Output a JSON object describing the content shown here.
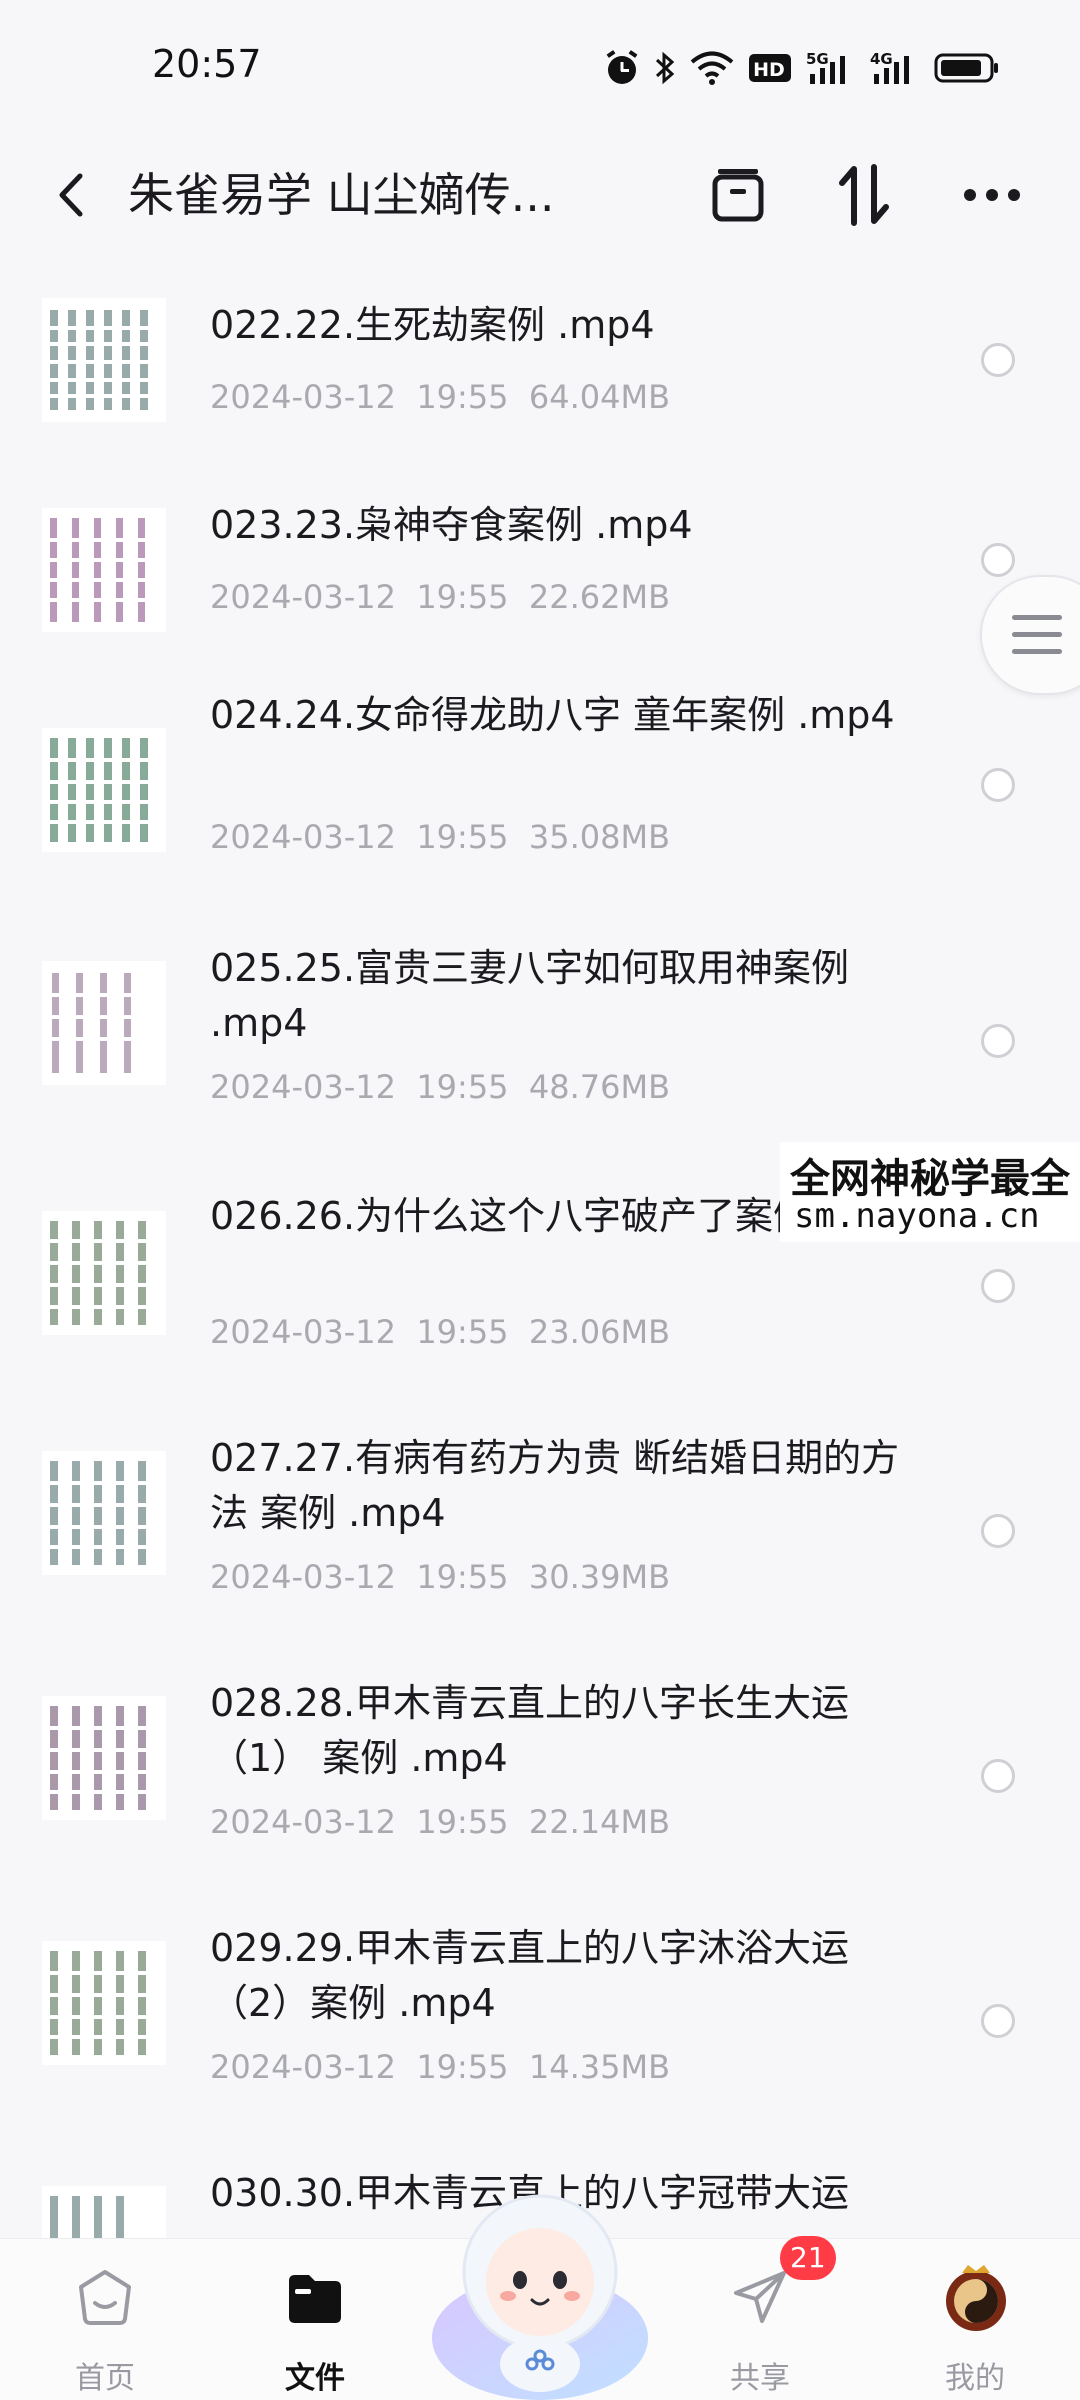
{
  "status_bar": {
    "time": "20:57",
    "icons": [
      "alarm-icon",
      "bluetooth-icon",
      "wifi-icon",
      "hd-icon",
      "signal-5g-icon",
      "signal-4g-icon",
      "battery-icon"
    ],
    "hd_label": "HD",
    "net1_label": "5G",
    "net2_label": "4G"
  },
  "header": {
    "title": "朱雀易学 山尘嫡传...",
    "back_icon": "back-arrow-icon",
    "actions": [
      "archive-icon",
      "sort-icon",
      "more-icon"
    ]
  },
  "files": [
    {
      "name": "022.22.生死劫案例 .mp4",
      "date": "2024-03-12",
      "time": "19:55",
      "size": "64.04MB"
    },
    {
      "name": "023.23.枭神夺食案例 .mp4",
      "date": "2024-03-12",
      "time": "19:55",
      "size": "22.62MB"
    },
    {
      "name": "024.24.女命得龙助八字 童年案例 .mp4",
      "date": "2024-03-12",
      "time": "19:55",
      "size": "35.08MB"
    },
    {
      "name": "025.25.富贵三妻八字如何取用神案例 .mp4",
      "date": "2024-03-12",
      "time": "19:55",
      "size": "48.76MB"
    },
    {
      "name": "026.26.为什么这个八字破产了案例 .mp4",
      "date": "2024-03-12",
      "time": "19:55",
      "size": "23.06MB"
    },
    {
      "name": "027.27.有病有药方为贵 断结婚日期的方法 案例 .mp4",
      "date": "2024-03-12",
      "time": "19:55",
      "size": "30.39MB"
    },
    {
      "name": "028.28.甲木青云直上的八字长生大运（1） 案例 .mp4",
      "date": "2024-03-12",
      "time": "19:55",
      "size": "22.14MB"
    },
    {
      "name": "029.29.甲木青云直上的八字沐浴大运（2）案例 .mp4",
      "date": "2024-03-12",
      "time": "19:55",
      "size": "14.35MB"
    },
    {
      "name": "030.30.甲木青云直上的八字冠带大运",
      "date": "",
      "time": "",
      "size": ""
    }
  ],
  "watermark": {
    "line1": "全网神秘学最全",
    "line2": "sm.nayona.cn"
  },
  "bottom_nav": {
    "items": [
      {
        "label": "首页",
        "icon": "home-icon",
        "active": false
      },
      {
        "label": "文件",
        "icon": "folder-icon",
        "active": true
      },
      {
        "label": "共享",
        "icon": "send-icon",
        "active": false
      },
      {
        "label": "我的",
        "icon": "profile-avatar-icon",
        "active": false
      }
    ],
    "share_badge": "21",
    "mascot_icon": "assistant-mascot-icon"
  },
  "colors": {
    "background": "#f7f7f9",
    "meta_text": "#a9a9b0",
    "badge": "#ff3b46",
    "active_nav": "#111111"
  }
}
